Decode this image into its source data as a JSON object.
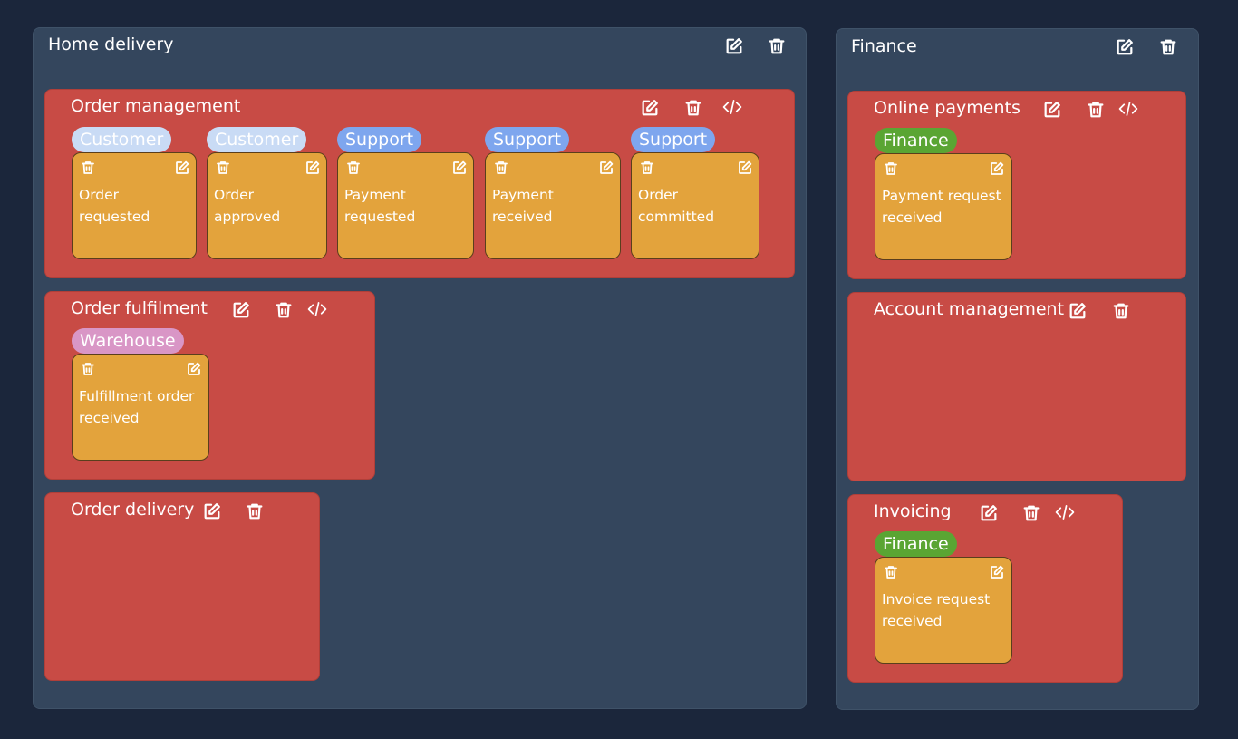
{
  "icons": {
    "edit": "edit-icon",
    "delete": "trash-icon",
    "code": "code-icon"
  },
  "domains": [
    {
      "title": "Home delivery",
      "contexts": [
        {
          "title": "Order management",
          "events": [
            {
              "tag": "Customer",
              "label": "Order requested"
            },
            {
              "tag": "Customer",
              "label": "Order approved"
            },
            {
              "tag": "Support",
              "label": "Payment requested"
            },
            {
              "tag": "Support",
              "label": "Payment received"
            },
            {
              "tag": "Support",
              "label": "Order committed"
            }
          ]
        },
        {
          "title": "Order fulfilment",
          "events": [
            {
              "tag": "Warehouse",
              "label": "Fulfillment order received"
            }
          ]
        },
        {
          "title": "Order delivery",
          "events": []
        }
      ]
    },
    {
      "title": "Finance",
      "contexts": [
        {
          "title": "Online payments",
          "events": [
            {
              "tag": "Finance",
              "label": "Payment request received"
            }
          ]
        },
        {
          "title": "Account management",
          "events": []
        },
        {
          "title": "Invoicing",
          "events": [
            {
              "tag": "Finance",
              "label": "Invoice request received"
            }
          ]
        }
      ]
    }
  ],
  "colors": {
    "background": "#1b263b",
    "domain": "#34465d",
    "context": "#c84b45",
    "event_card": "#e3a33c",
    "tag_customer": "#c9dbf5",
    "tag_support": "#7ea6ee",
    "tag_warehouse": "#d996c6",
    "tag_finance": "#5aa533"
  }
}
